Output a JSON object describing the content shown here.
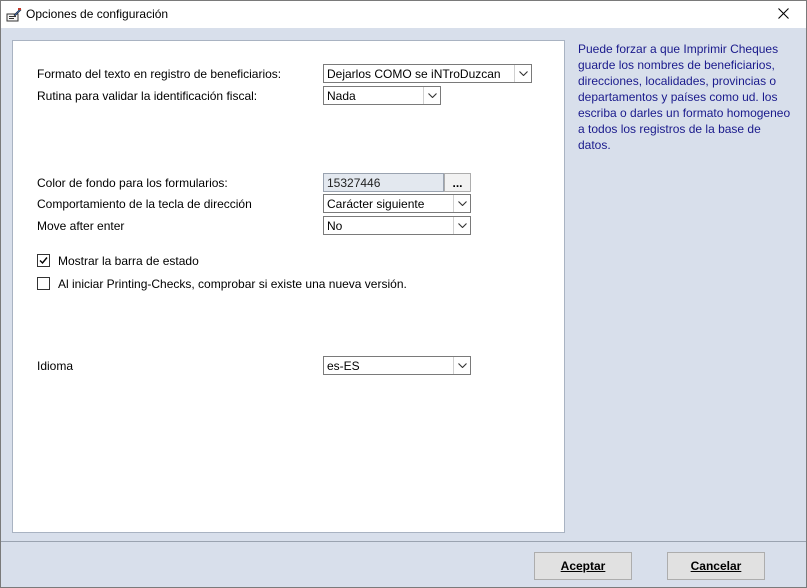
{
  "window": {
    "title": "Opciones de configuración",
    "icon": "app-settings-icon",
    "close_icon": "close-icon"
  },
  "form": {
    "beneficiary_format": {
      "label": "Formato del texto en registro de beneficiarios:",
      "value": "Dejarlos COMO se iNTroDuzcan"
    },
    "tax_id_routine": {
      "label": "Rutina para validar la identificación fiscal:",
      "value": "Nada"
    },
    "form_background": {
      "label": "Color de fondo para los formularios:",
      "value": "15327446",
      "button_label": "..."
    },
    "arrow_key_behavior": {
      "label": "Comportamiento de la tecla de dirección",
      "value": "Carácter siguiente"
    },
    "move_after_enter": {
      "label": "Move after enter",
      "value": "No"
    },
    "show_status_bar": {
      "label": "Mostrar la barra de estado",
      "checked": true
    },
    "check_new_version": {
      "label": "Al iniciar Printing-Checks, comprobar si existe una nueva versión.",
      "checked": false
    },
    "language": {
      "label": "Idioma",
      "value": "es-ES"
    }
  },
  "help_text": "Puede forzar a que Imprimir Cheques guarde los nombres de beneficiarios, direcciones, localidades, provincias o departamentos y países como ud. los escriba o darles un formato homogeneo a todos los registros de la base de datos.",
  "buttons": {
    "accept": "Aceptar",
    "cancel": "Cancelar"
  },
  "colors": {
    "client_background": "#d8dfeb",
    "help_text": "#1a1a8c"
  }
}
